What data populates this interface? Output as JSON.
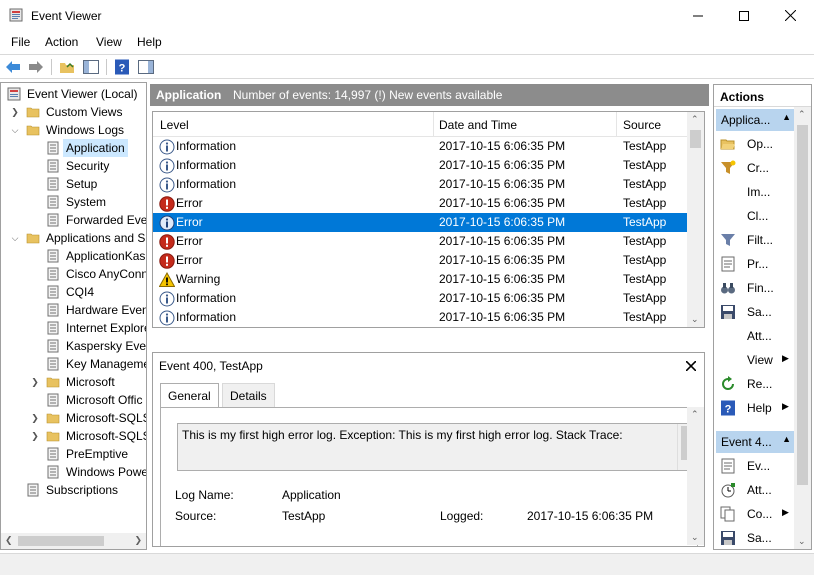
{
  "window": {
    "title": "Event Viewer",
    "controls": {
      "minimize": "—",
      "maximize": "☐",
      "close": "✕"
    }
  },
  "menu": [
    "File",
    "Action",
    "View",
    "Help"
  ],
  "tree": {
    "root": "Event Viewer (Local)",
    "custom_views": "Custom Views",
    "windows_logs": "Windows Logs",
    "windows_logs_children": [
      "Application",
      "Security",
      "Setup",
      "System",
      "Forwarded Even"
    ],
    "apps_services": "Applications and S",
    "apps_services_children": [
      "ApplicationKas",
      "Cisco AnyConn",
      "CQI4",
      "Hardware Even",
      "Internet Explore",
      "Kaspersky Even",
      "Key Manageme",
      "Microsoft",
      "Microsoft Offic",
      "Microsoft-SQLS",
      "Microsoft-SQLS",
      "PreEmptive",
      "Windows Powe"
    ],
    "subscriptions": "Subscriptions"
  },
  "center": {
    "log_name": "Application",
    "summary": "Number of events: 14,997 (!) New events available"
  },
  "grid": {
    "columns": [
      "Level",
      "Date and Time",
      "Source"
    ],
    "rows": [
      {
        "level": "Information",
        "date": "2017-10-15 6:06:35 PM",
        "source": "TestApp",
        "icon": "info-icon"
      },
      {
        "level": "Information",
        "date": "2017-10-15 6:06:35 PM",
        "source": "TestApp",
        "icon": "info-icon"
      },
      {
        "level": "Information",
        "date": "2017-10-15 6:06:35 PM",
        "source": "TestApp",
        "icon": "info-icon"
      },
      {
        "level": "Error",
        "date": "2017-10-15 6:06:35 PM",
        "source": "TestApp",
        "icon": "error-icon"
      },
      {
        "level": "Error",
        "date": "2017-10-15 6:06:35 PM",
        "source": "TestApp",
        "icon": "error-icon"
      },
      {
        "level": "Error",
        "date": "2017-10-15 6:06:35 PM",
        "source": "TestApp",
        "icon": "error-icon"
      },
      {
        "level": "Error",
        "date": "2017-10-15 6:06:35 PM",
        "source": "TestApp",
        "icon": "error-icon"
      },
      {
        "level": "Warning",
        "date": "2017-10-15 6:06:35 PM",
        "source": "TestApp",
        "icon": "warning-icon"
      },
      {
        "level": "Information",
        "date": "2017-10-15 6:06:35 PM",
        "source": "TestApp",
        "icon": "info-icon"
      },
      {
        "level": "Information",
        "date": "2017-10-15 6:06:35 PM",
        "source": "TestApp",
        "icon": "info-icon"
      }
    ]
  },
  "detail": {
    "header": "Event 400, TestApp",
    "close": "✕",
    "tabs": [
      "General",
      "Details"
    ],
    "description": "This is my first high error log. Exception: This is my first high error log. Stack Trace:",
    "log_name_label": "Log Name:",
    "log_name_value": "Application",
    "source_label": "Source:",
    "source_value": "TestApp",
    "logged_label": "Logged:",
    "logged_value": "2017-10-15 6:06:35 PM"
  },
  "actions": {
    "title": "Actions",
    "section1": "Applica...",
    "items1": [
      {
        "label": "Op...",
        "icon": "open-folder-icon"
      },
      {
        "label": "Cr...",
        "icon": "create-filter-icon"
      },
      {
        "label": "Im...",
        "icon": ""
      },
      {
        "label": "Cl...",
        "icon": ""
      },
      {
        "label": "Filt...",
        "icon": "filter-icon"
      },
      {
        "label": "Pr...",
        "icon": "properties-icon"
      },
      {
        "label": "Fin...",
        "icon": "find-icon"
      },
      {
        "label": "Sa...",
        "icon": "save-icon"
      },
      {
        "label": "Att...",
        "icon": ""
      },
      {
        "label": "View",
        "icon": "",
        "arrow": "▶"
      },
      {
        "label": "Re...",
        "icon": "refresh-icon"
      },
      {
        "label": "Help",
        "icon": "help-icon",
        "arrow": "▶"
      }
    ],
    "section2": "Event 4...",
    "items2": [
      {
        "label": "Ev...",
        "icon": "event-properties-icon"
      },
      {
        "label": "Att...",
        "icon": "attach-task-icon"
      },
      {
        "label": "Co...",
        "icon": "copy-icon",
        "arrow": "▶"
      },
      {
        "label": "Sa...",
        "icon": "save-icon"
      }
    ]
  },
  "colors": {
    "selection": "#0078d7",
    "tree_selection": "#cce8ff",
    "header_band": "#8c8c8c",
    "actions_section": "#b8d4ee"
  }
}
